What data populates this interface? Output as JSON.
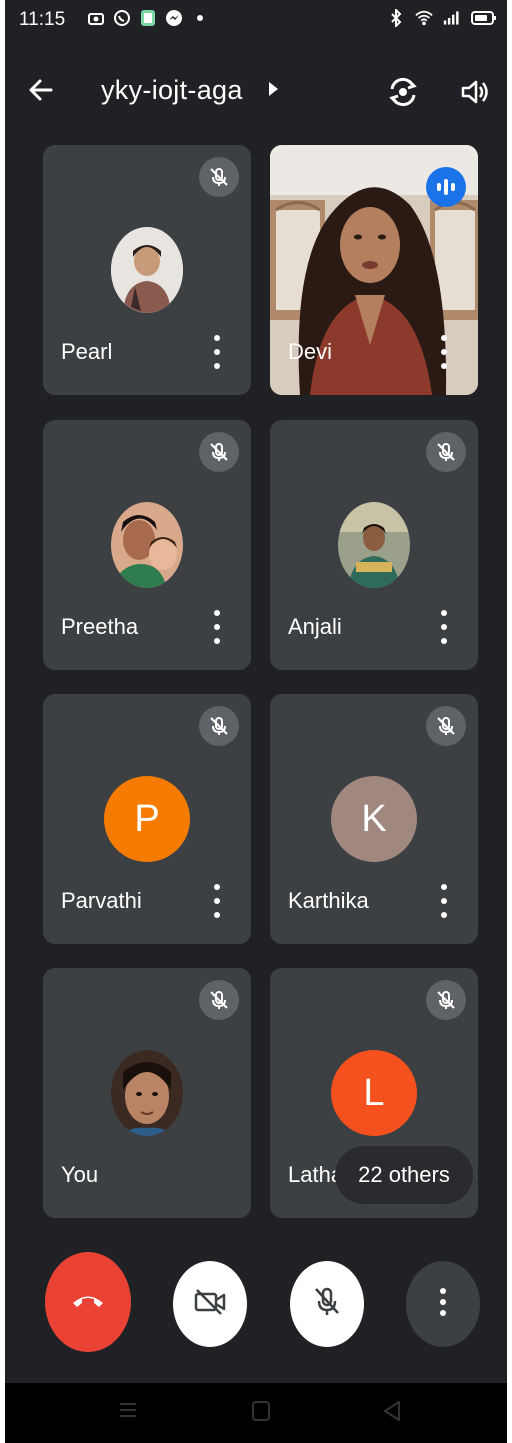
{
  "status_bar": {
    "time": "11:15"
  },
  "top_bar": {
    "meeting_code": "yky-iojt-aga"
  },
  "participants": [
    {
      "name": "Pearl",
      "muted": true
    },
    {
      "name": "Devi",
      "speaking": true
    },
    {
      "name": "Preetha",
      "muted": true
    },
    {
      "name": "Anjali",
      "muted": true
    },
    {
      "name": "Parvathi",
      "initial": "P",
      "avatar_color": "#f57c00",
      "muted": true
    },
    {
      "name": "Karthika",
      "initial": "K",
      "avatar_color": "#a1887f",
      "muted": true
    },
    {
      "name": "You",
      "muted": true
    },
    {
      "name": "Latha",
      "initial": "L",
      "avatar_color": "#f4511e",
      "muted": true
    }
  ],
  "others_label": "22 others",
  "colors": {
    "background": "#202124",
    "tile": "#3c4043",
    "end_call": "#ea4335",
    "speaking": "#1a73e8"
  },
  "icons": {
    "back": "arrow-left-icon",
    "flip_camera": "flip-camera-icon",
    "speaker": "speaker-icon",
    "mic_off": "mic-off-icon",
    "camera_off": "camera-off-icon",
    "end_call": "phone-hangup-icon",
    "more": "more-vertical-icon"
  }
}
